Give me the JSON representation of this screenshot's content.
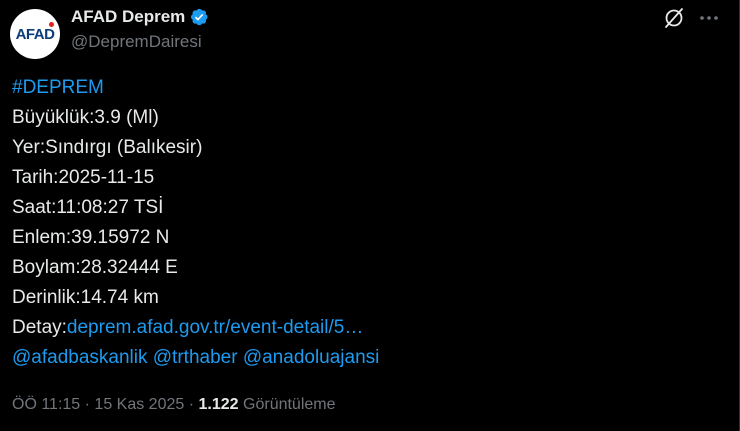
{
  "author": {
    "avatar_text": "AFAD",
    "name": "AFAD Deprem",
    "handle": "@DepremDairesi",
    "verified_color": "#1d9bf0"
  },
  "icons": {
    "grok": "grok-icon",
    "more": "more-icon",
    "verified": "verified-badge-icon"
  },
  "tweet": {
    "hashtag": "#DEPREM",
    "lines": {
      "magnitude": "Büyüklük:3.9 (Ml)",
      "location": "Yer:Sındırgı (Balıkesir)",
      "date": "Tarih:2025-11-15",
      "time": "Saat:11:08:27 TSİ",
      "latitude": "Enlem:39.15972 N",
      "longitude": "Boylam:28.32444 E",
      "depth": "Derinlik:14.74 km"
    },
    "detail_label": "Detay:",
    "detail_link": "deprem.afad.gov.tr/event-detail/5…",
    "mentions": [
      "@afadbaskanlik",
      "@trthaber",
      "@anadoluajansi"
    ]
  },
  "meta": {
    "time": "ÖÖ 11:15",
    "separator": "·",
    "date": "15 Kas 2025",
    "views_count": "1.122",
    "views_label": "Görüntüleme"
  },
  "colors": {
    "background": "#000000",
    "text": "#e7e9ea",
    "muted": "#71767b",
    "link": "#1d9bf0"
  }
}
